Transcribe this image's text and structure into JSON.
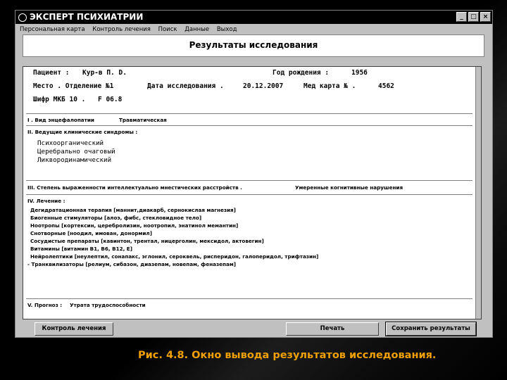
{
  "window": {
    "title": "ЭКСПЕРТ ПСИХИАТРИИ",
    "controls": [
      "_",
      "□",
      "×"
    ]
  },
  "menu": [
    "Персональная карта",
    "Контроль лечения",
    "Поиск",
    "Данные",
    "Выход"
  ],
  "heading": "Результаты исследования",
  "patient": {
    "name_label": "Пациент :",
    "name_value": "Кур-в П. D.",
    "birth_label": "Год рождения :",
    "birth_value": "1956",
    "place_label": "Место . Отделение №1",
    "date_label": "Дата исследования .",
    "date_value": "20.12.2007",
    "card_label": "Мед карта № .",
    "card_value": "4562",
    "icd_label": "Шифр МКБ 10 .",
    "icd_value": "F 06.8"
  },
  "sections": {
    "s1_label": "I . Вид энцефалопатии",
    "s1_value": "Травматическая",
    "s2_label": "II. Ведущие клинические синдромы :",
    "s2_items": [
      "Психоорганический",
      "Церебрально очаговый",
      "Ликвородинамический"
    ],
    "s3_label": "III. Степень выраженности интеллектуально мнестических расстройств .",
    "s3_value": "Умеренные когнитивные нарушения",
    "s4_label": "IV. Лечение :",
    "s4_items": [
      "Дегидратационная терапия [маннит,диакарб, сернокислая магнезия]",
      "Биогенные стимуляторы [алоэ, фибс, стекловидное тело]",
      "Ноотропы [кортексин, церебролизин, ноотропил, энатинол мемантин]",
      "Снотворные [ноодил, имован, донормил]",
      "Сосудистые препараты [кавинтон, трентал, ницерголин, мексидол, актовегин]",
      "Витамины [витамин B1, B6, B12, E]",
      "Нейролептики [неулептил, сонапакс, эглонил, сероквель, рисперидон, галоперидол, трифтазин]",
      "- Транквилизаторы [релиум, сибазон, диазепам, новепам, феназепам]"
    ],
    "s5_label": "V. Прогноз :",
    "s5_value": "Утрата трудоспособности"
  },
  "buttons": {
    "treatment": "Контроль лечения",
    "print": "Печать",
    "save": "Сохранить результаты"
  },
  "caption": "Рис. 4.8. Окно вывода результатов исследования."
}
